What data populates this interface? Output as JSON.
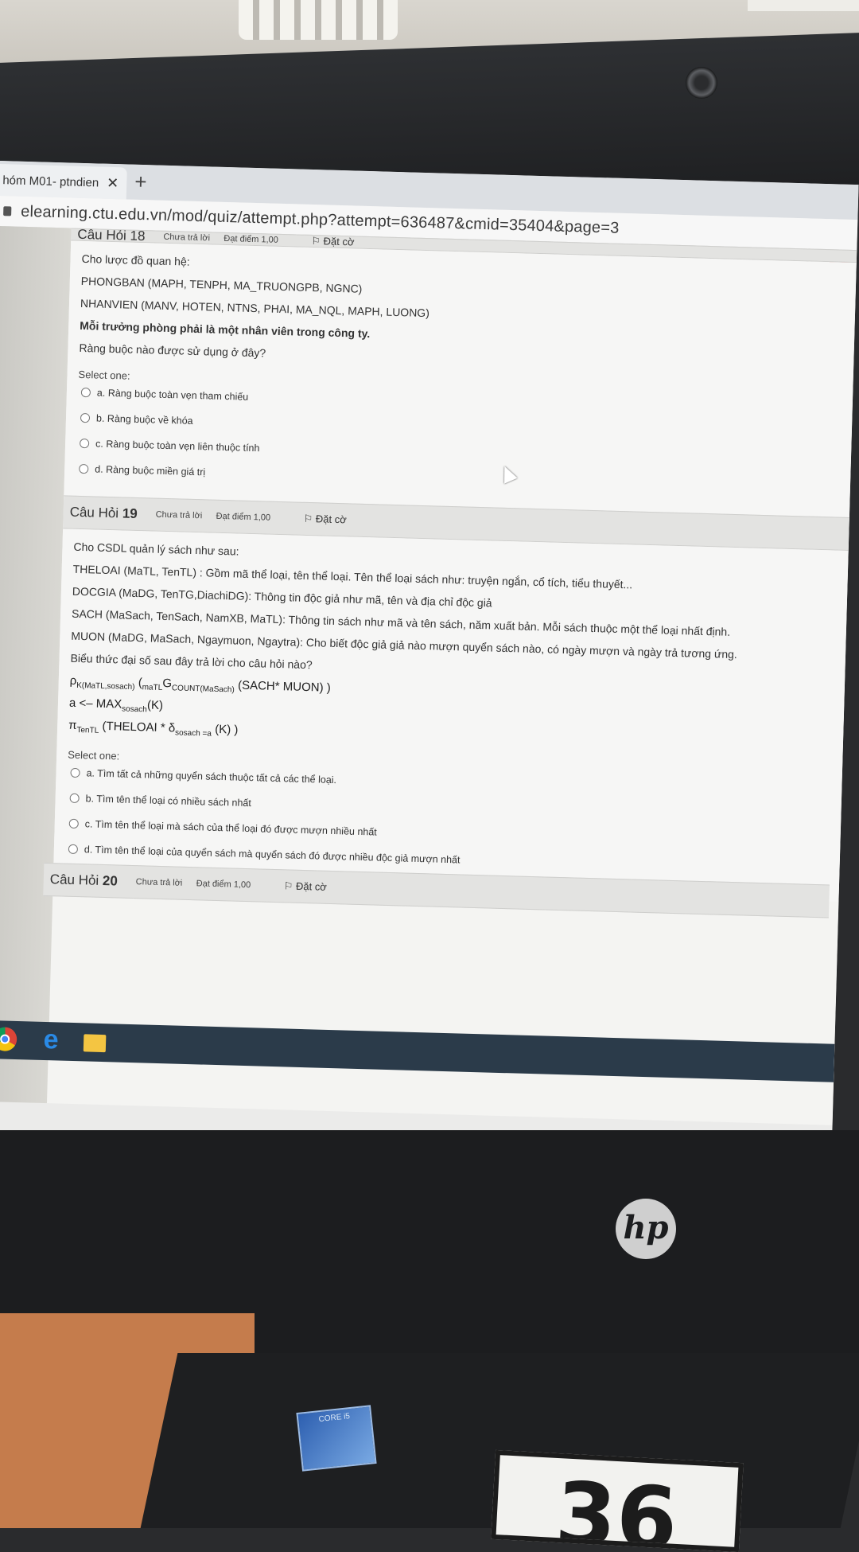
{
  "browser": {
    "tab_title": "hóm M01- ptndien",
    "tab_close": "✕",
    "new_tab": "+",
    "url": "elearning.ctu.edu.vn/mod/quiz/attempt.php?attempt=636487&cmid=35404&page=3"
  },
  "q18": {
    "header_partial": "Câu Hỏi 18",
    "state": "Chưa trả lời",
    "mark": "Đạt điểm 1,00",
    "flag": "Đặt cờ",
    "lines": [
      "Cho lược đồ quan hệ:",
      "PHONGBAN (MAPH, TENPH, MA_TRUONGPB, NGNC)",
      "NHANVIEN (MANV, HOTEN, NTNS, PHAI, MA_NQL, MAPH, LUONG)",
      "Mỗi trưởng phòng phải là một nhân viên trong công ty.",
      "Ràng buộc nào được sử dụng ở đây?"
    ],
    "select_one": "Select one:",
    "options": [
      "a.  Ràng buộc toàn vẹn tham chiếu",
      "b.  Ràng buộc về khóa",
      "c.  Ràng buộc toàn vẹn liên thuộc tính",
      "d.  Ràng buộc miền giá trị"
    ]
  },
  "q19": {
    "number_prefix": "Câu Hỏi",
    "number": "19",
    "state": "Chưa trả lời",
    "mark": "Đạt điểm 1,00",
    "flag": "Đặt cờ",
    "lines": [
      "Cho CSDL quản lý sách như sau:",
      "THELOAI (MaTL, TenTL) : Gồm mã thể loại, tên thể loại. Tên thể loại sách như: truyện ngắn, cổ tích, tiểu thuyết...",
      "DOCGIA (MaDG, TenTG,DiachiDG): Thông tin độc giả như mã, tên và địa chỉ độc giả",
      "SACH (MaSach, TenSach, NamXB, MaTL): Thông tin sách như mã và tên sách, năm xuất bản. Mỗi sách thuộc một thể loại nhất định.",
      "MUON (MaDG, MaSach, Ngaymuon, Ngaytra): Cho biết độc giả giả nào mượn quyển sách nào, có ngày mượn và ngày trả tương ứng.",
      "Biểu thức đại số sau đây trả lời cho câu hỏi nào?"
    ],
    "formula": {
      "rho": "ρ",
      "rho_sub": "K(MaTL,sosach)",
      "open": "(",
      "matl": "maTL",
      "G": "G",
      "count_sub": "COUNT(MaSach)",
      "tail": "(SACH* MUON) )",
      "line2_a": "a <– MAX",
      "line2_sub": "sosach",
      "line2_tail": "(K)",
      "pi": "π",
      "pi_sub": "TenTL",
      "line3_mid": "(THELOAI * δ",
      "delta_sub": "sosach =a",
      "line3_tail": "(K) )"
    },
    "select_one": "Select one:",
    "options": [
      "a.  Tìm tất cả những quyển sách thuộc tất cả các thể loại.",
      "b.  Tìm tên thể loại có nhiều sách nhất",
      "c.  Tìm tên thể loại mà sách của thể loại đó được mượn nhiều nhất",
      "d.  Tìm tên thể loại của quyển sách mà quyển sách đó được nhiều độc giả mượn nhất"
    ]
  },
  "q20": {
    "number_prefix": "Câu Hỏi",
    "number": "20",
    "state": "Chưa trả lời",
    "mark": "Đạt điểm 1,00",
    "flag": "Đặt cờ"
  },
  "hardware": {
    "brand": "hp",
    "sticker": "CORE i5",
    "label": "36"
  },
  "icons": [
    "chrome-icon",
    "edge-icon",
    "file-explorer-icon",
    "lock-icon",
    "flag-icon",
    "radio-icon"
  ]
}
